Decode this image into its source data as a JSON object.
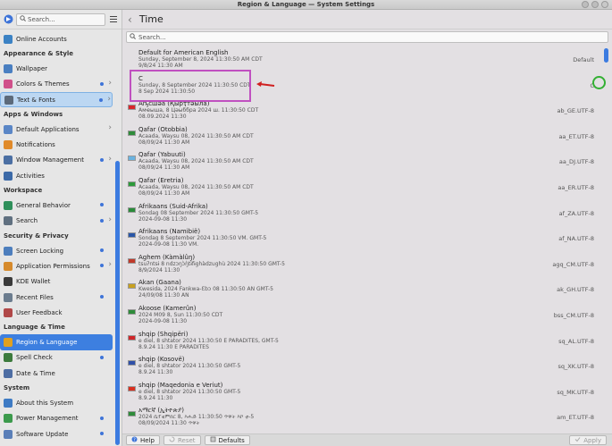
{
  "window": {
    "title": "Region & Language — System Settings"
  },
  "sidebar": {
    "search_placeholder": "Search...",
    "items": [
      {
        "label": "Online Accounts",
        "color": "#3b82c4",
        "icon": "accounts-icon"
      },
      {
        "category": "Appearance & Style"
      },
      {
        "label": "Wallpaper",
        "color": "#4a7fc1",
        "icon": "wallpaper-icon"
      },
      {
        "label": "Colors & Themes",
        "color": "#d0508a",
        "icon": "palette-icon",
        "dot": true,
        "chevron": true
      },
      {
        "label": "Text & Fonts",
        "color": "#5c6a7a",
        "icon": "fonts-icon",
        "dot": true,
        "chevron": true,
        "hovered": true
      },
      {
        "category": "Apps & Windows"
      },
      {
        "label": "Default Applications",
        "color": "#5a86c6",
        "icon": "apps-icon",
        "chevron": true
      },
      {
        "label": "Notifications",
        "color": "#e08a2a",
        "icon": "bell-icon"
      },
      {
        "label": "Window Management",
        "color": "#4b6fa3",
        "icon": "window-icon",
        "dot": true,
        "chevron": true
      },
      {
        "label": "Activities",
        "color": "#3c6aa8",
        "icon": "activities-icon"
      },
      {
        "category": "Workspace"
      },
      {
        "label": "General Behavior",
        "color": "#2f8f5a",
        "icon": "behavior-icon",
        "dot": true
      },
      {
        "label": "Search",
        "color": "#607080",
        "icon": "search-icon",
        "dot": true,
        "chevron": true
      },
      {
        "category": "Security & Privacy"
      },
      {
        "label": "Screen Locking",
        "color": "#4d7ebd",
        "icon": "lock-icon",
        "dot": true
      },
      {
        "label": "Application Permissions",
        "color": "#d68a2c",
        "icon": "shield-icon",
        "dot": true,
        "chevron": true
      },
      {
        "label": "KDE Wallet",
        "color": "#3a3a3a",
        "icon": "wallet-icon"
      },
      {
        "label": "Recent Files",
        "color": "#6b7c8e",
        "icon": "recent-icon",
        "dot": true
      },
      {
        "label": "User Feedback",
        "color": "#b04848",
        "icon": "feedback-icon"
      },
      {
        "category": "Language & Time"
      },
      {
        "label": "Region & Language",
        "color": "#e0a020",
        "icon": "flag-icon",
        "selected": true
      },
      {
        "label": "Spell Check",
        "color": "#3c7a3c",
        "icon": "spellcheck-icon",
        "dot": true
      },
      {
        "label": "Date & Time",
        "color": "#4d6da3",
        "icon": "clock-icon"
      },
      {
        "category": "System"
      },
      {
        "label": "About this System",
        "color": "#3e7bc4",
        "icon": "info-icon"
      },
      {
        "label": "Power Management",
        "color": "#3c9a4c",
        "icon": "power-icon",
        "dot": true
      },
      {
        "label": "Software Update",
        "color": "#5a7fb8",
        "icon": "update-icon",
        "dot": true
      }
    ]
  },
  "main": {
    "title": "Time",
    "search_placeholder": "Search...",
    "locales": [
      {
        "name": "Default for American English",
        "line1": "Sunday, September 8, 2024 11:30:50 AM CDT",
        "line2": "9/8/24 11:30 AM",
        "code": "Default",
        "flag": ""
      },
      {
        "name": "C",
        "line1": "Sunday, 8 September 2024 11:30:50 CDT",
        "line2": "8 Sep 2024 11:30:50",
        "code": "C",
        "flag": ""
      },
      {
        "name": "Аҧсшәа (Қырҭтәыла)",
        "line1": "Амҽыша, 8 Цәыббра 2024 ш. 11:30:50 CDT",
        "line2": "08.09.2024 11:30",
        "code": "ab_GE.UTF-8",
        "flag": "#d9262b"
      },
      {
        "name": "Qafar (Otobbia)",
        "line1": "Acaada, Waysu 08, 2024 11:30:50 AM CDT",
        "line2": "08/09/24 11:30 AM",
        "code": "aa_ET.UTF-8",
        "flag": "#2e8b3a"
      },
      {
        "name": "Qafar (Yabuuti)",
        "line1": "Acaada, Waysu 08, 2024 11:30:50 AM CDT",
        "line2": "08/09/24 11:30 AM",
        "code": "aa_DJ.UTF-8",
        "flag": "#6ab2e0"
      },
      {
        "name": "Qafar (Eretria)",
        "line1": "Acaada, Waysu 08, 2024 11:30:50 AM CDT",
        "line2": "08/09/24 11:30 AM",
        "code": "aa_ER.UTF-8",
        "flag": "#2c9a3a"
      },
      {
        "name": "Afrikaans (Suid-Afrika)",
        "line1": "Sondag 08 September 2024 11:30:50 GMT-5",
        "line2": "2024-09-08 11:30",
        "code": "af_ZA.UTF-8",
        "flag": "#2a8a3a"
      },
      {
        "name": "Afrikaans (Namibië)",
        "line1": "Sondag 8 September 2024 11:30:50 VM. GMT-5",
        "line2": "2024-09-08 11:30 VM.",
        "code": "af_NA.UTF-8",
        "flag": "#2a56a8"
      },
      {
        "name": "Aghem (Kàmàlûŋ)",
        "line1": "tsuʔntsɨ 8 ndzɔŋɔ̀ŋ̀tɨ̀fɨghàdzughù 2024 11:30:50 GMT-5",
        "line2": "8/9/2024 11:30",
        "code": "agq_CM.UTF-8",
        "flag": "#c0392b"
      },
      {
        "name": "Akan (Gaana)",
        "line1": "Kwesida, 2024 Fankwa-Ɛbɔ 08 11:30:50 AN GMT-5",
        "line2": "24/09/08 11:30 AN",
        "code": "ak_GH.UTF-8",
        "flag": "#c8a020"
      },
      {
        "name": "Akoose (Kamerûn)",
        "line1": "2024 M09 8, Sun 11:30:50 CDT",
        "line2": "2024-09-08 11:30",
        "code": "bss_CM.UTF-8",
        "flag": "#2e8b3a"
      },
      {
        "name": "shqip (Shqipëri)",
        "line1": "e diel, 8 shtator 2024 11:30:50 E PARADITES, GMT-5",
        "line2": "8.9.24 11:30 E PARADITES",
        "code": "sq_AL.UTF-8",
        "flag": "#d0262b"
      },
      {
        "name": "shqip (Kosovë)",
        "line1": "e diel, 8 shtator 2024 11:30:50 GMT-5",
        "line2": "8.9.24 11:30",
        "code": "sq_XK.UTF-8",
        "flag": "#3050a8"
      },
      {
        "name": "shqip (Maqedonia e Veriut)",
        "line1": "e diel, 8 shtator 2024 11:30:50 GMT-5",
        "line2": "8.9.24 11:30",
        "code": "sq_MK.UTF-8",
        "flag": "#d93020"
      },
      {
        "name": "አማርኛ (ኢትዮጵያ)",
        "line1": "2024 ሴፕቴምበር 8, እሑድ 11:30:50 ጥዋት እኮ ቲ-5",
        "line2": "08/09/2024 11:30 ጥዋት",
        "code": "am_ET.UTF-8",
        "flag": "#2e8b3a"
      }
    ]
  },
  "footer": {
    "help": "Help",
    "reset": "Reset",
    "defaults": "Defaults",
    "apply": "Apply"
  }
}
